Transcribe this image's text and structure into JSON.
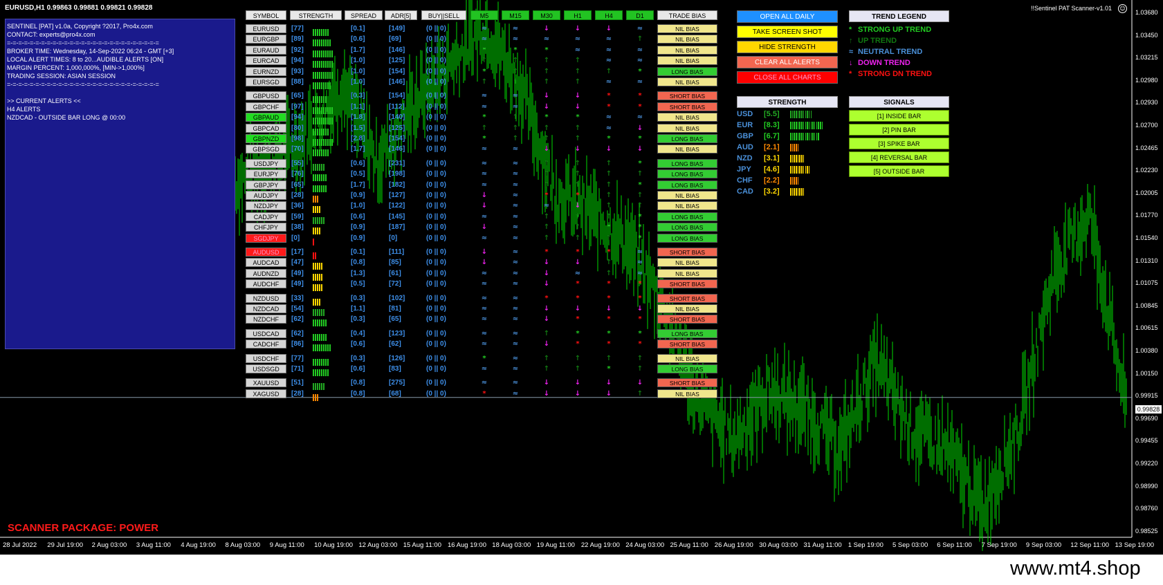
{
  "window": {
    "title": "EURUSD,H1  0.99863 0.99881 0.99821 0.99828",
    "scanner_name": "!!Sentinel PAT Scanner-v1.01"
  },
  "info_panel": {
    "lines": [
      "SENTINEL [PAT] v1.0a, Copyright ?2017, Pro4x.com",
      "CONTACT: experts@pro4x.com",
      "=-=-=-=-=-=-=-=-=-=-=-=-=-=-=-=-=-=-=-=-=-=-=-=-=-=-=",
      "BROKER TIME: Wednesday, 14-Sep-2022 06:24 - GMT [+3]",
      "LOCAL ALERT TIMES: 8 to 20...AUDIBLE ALERTS [ON]",
      "MARGIN PERCENT: 1,000,000%, [MIN->1,000%]",
      "TRADING SESSION: ASIAN SESSION",
      "=-=-=-=-=-=-=-=-=-=-=-=-=-=-=-=-=-=-=-=-=-=-=-=-=-=-=",
      "",
      ">> CURRENT ALERTS <<",
      "H4 ALERTS",
      "NZDCAD - OUTSIDE BAR LONG @ 00:00"
    ],
    "package_label": "SCANNER PACKAGE: POWER"
  },
  "table_headers": {
    "symbol": "SYMBOL",
    "strength": "STRENGTH",
    "spread": "SPREAD",
    "adr": "ADR[5]",
    "buysell": "BUY||SELL",
    "m5": "M5",
    "m15": "M15",
    "m30": "M30",
    "h1": "H1",
    "h4": "H4",
    "d1": "D1",
    "bias": "TRADE BIAS"
  },
  "colors": {
    "symbol_default": "#d6d6d6",
    "symbol_green": "#22dd22",
    "symbol_red": "#ff1a1a",
    "nil_bias": "#f0e68c",
    "long_bias": "#33cc33",
    "short_bias": "#f26650",
    "strong_up": "#22cc22",
    "up": "#117711",
    "neutral": "#4a90d9",
    "down": "#ee22ee",
    "strong_down": "#ff1111",
    "chart_line": "#00dd00",
    "number_blue": "#3d8ee8"
  },
  "pairs": [
    {
      "symbol": "EURUSD",
      "state": "default",
      "strength": "[77]",
      "spread": "[0.1]",
      "adr": "[149]",
      "buysell": "(0 || 0)",
      "tf": [
        "n",
        "n",
        "d",
        "d",
        "d",
        "n"
      ],
      "bias": "NIL BIAS",
      "bias_type": "nil",
      "bar": {
        "color": "#22cc22",
        "count": 8
      }
    },
    {
      "symbol": "EURGBP",
      "state": "default",
      "strength": "[89]",
      "spread": "[0.6]",
      "adr": "[69]",
      "buysell": "(0 || 0)",
      "tf": [
        "n",
        "n",
        "n",
        "n",
        "n",
        "u"
      ],
      "bias": "NIL BIAS",
      "bias_type": "nil",
      "bar": {
        "color": "#22cc22",
        "count": 9
      }
    },
    {
      "symbol": "EURAUD",
      "state": "default",
      "strength": "[92]",
      "spread": "[1.7]",
      "adr": "[146]",
      "buysell": "(0 || 0)",
      "tf": [
        "su",
        "su",
        "su",
        "n",
        "n",
        "n"
      ],
      "bias": "NIL BIAS",
      "bias_type": "nil",
      "bar": {
        "color": "#22cc22",
        "count": 10
      }
    },
    {
      "symbol": "EURCAD",
      "state": "default",
      "strength": "[94]",
      "spread": "[1.0]",
      "adr": "[125]",
      "buysell": "(0 || 0)",
      "tf": [
        "u",
        "u",
        "u",
        "u",
        "n",
        "n"
      ],
      "bias": "NIL BIAS",
      "bias_type": "nil",
      "bar": {
        "color": "#22cc22",
        "count": 10
      }
    },
    {
      "symbol": "EURNZD",
      "state": "default",
      "strength": "[93]",
      "spread": "[1.0]",
      "adr": "[154]",
      "buysell": "(0 || 0)",
      "tf": [
        "su",
        "u",
        "u",
        "u",
        "u",
        "su"
      ],
      "bias": "LONG BIAS",
      "bias_type": "long",
      "bar": {
        "color": "#22cc22",
        "count": 10
      }
    },
    {
      "symbol": "EURSGD",
      "state": "default",
      "strength": "[88]",
      "spread": "[1.0]",
      "adr": "[146]",
      "buysell": "(0 || 0)",
      "tf": [
        "u",
        "u",
        "u",
        "u",
        "n",
        "n"
      ],
      "bias": "NIL BIAS",
      "bias_type": "nil",
      "bar": {
        "color": "#22cc22",
        "count": 9
      }
    },
    {
      "symbol": "GBPUSD",
      "state": "default",
      "strength": "[65]",
      "spread": "[0.3]",
      "adr": "[154]",
      "buysell": "(0 || 0)",
      "tf": [
        "n",
        "n",
        "d",
        "d",
        "sd",
        "sd"
      ],
      "bias": "SHORT BIAS",
      "bias_type": "short",
      "bar": {
        "color": "#22cc22",
        "count": 7
      }
    },
    {
      "symbol": "GBPCHF",
      "state": "default",
      "strength": "[97]",
      "spread": "[1.1]",
      "adr": "[112]",
      "buysell": "(0 || 0)",
      "tf": [
        "n",
        "n",
        "d",
        "d",
        "sd",
        "sd"
      ],
      "bias": "SHORT BIAS",
      "bias_type": "short",
      "bar": {
        "color": "#22cc22",
        "count": 10
      }
    },
    {
      "symbol": "GBPAUD",
      "state": "green",
      "strength": "[94]",
      "spread": "[1.8]",
      "adr": "[140]",
      "buysell": "(0 || 0)",
      "tf": [
        "su",
        "u",
        "su",
        "su",
        "n",
        "n"
      ],
      "bias": "NIL BIAS",
      "bias_type": "nil",
      "bar": {
        "color": "#22cc22",
        "count": 10
      }
    },
    {
      "symbol": "GBPCAD",
      "state": "default",
      "strength": "[80]",
      "spread": "[1.5]",
      "adr": "[125]",
      "buysell": "(0 || 0)",
      "tf": [
        "u",
        "u",
        "u",
        "u",
        "n",
        "d"
      ],
      "bias": "NIL BIAS",
      "bias_type": "nil",
      "bar": {
        "color": "#22cc22",
        "count": 8
      }
    },
    {
      "symbol": "GBPNZD",
      "state": "green",
      "strength": "[98]",
      "spread": "[2.8]",
      "adr": "[154]",
      "buysell": "(0 || 0)",
      "tf": [
        "su",
        "u",
        "u",
        "u",
        "su",
        "su"
      ],
      "bias": "LONG BIAS",
      "bias_type": "long",
      "bar": {
        "color": "#22cc22",
        "count": 10
      }
    },
    {
      "symbol": "GBPSGD",
      "state": "default",
      "strength": "[70]",
      "spread": "[1.7]",
      "adr": "[146]",
      "buysell": "(0 || 0)",
      "tf": [
        "n",
        "n",
        "d",
        "d",
        "d",
        "d"
      ],
      "bias": "NIL BIAS",
      "bias_type": "nil",
      "bar": {
        "color": "#22cc22",
        "count": 8
      }
    },
    {
      "symbol": "USDJPY",
      "state": "default",
      "strength": "[55]",
      "spread": "[0.6]",
      "adr": "[231]",
      "buysell": "(0 || 0)",
      "tf": [
        "n",
        "n",
        "u",
        "u",
        "u",
        "su"
      ],
      "bias": "LONG BIAS",
      "bias_type": "long",
      "bar": {
        "color": "#22aa22",
        "count": 6
      }
    },
    {
      "symbol": "EURJPY",
      "state": "default",
      "strength": "[76]",
      "spread": "[0.5]",
      "adr": "[198]",
      "buysell": "(0 || 0)",
      "tf": [
        "n",
        "n",
        "u",
        "u",
        "u",
        "u"
      ],
      "bias": "LONG BIAS",
      "bias_type": "long",
      "bar": {
        "color": "#22cc22",
        "count": 7
      }
    },
    {
      "symbol": "GBPJPY",
      "state": "default",
      "strength": "[65]",
      "spread": "[1.7]",
      "adr": "[182]",
      "buysell": "(0 || 0)",
      "tf": [
        "n",
        "n",
        "u",
        "u",
        "u",
        "su"
      ],
      "bias": "LONG BIAS",
      "bias_type": "long",
      "bar": {
        "color": "#22cc22",
        "count": 7
      }
    },
    {
      "symbol": "AUDJPY",
      "state": "default",
      "strength": "[28]",
      "spread": "[0.9]",
      "adr": "[127]",
      "buysell": "(0 || 0)",
      "tf": [
        "d",
        "n",
        "sd",
        "sd",
        "u",
        "u"
      ],
      "bias": "NIL BIAS",
      "bias_type": "nil",
      "bar": {
        "color": "#ff8800",
        "count": 3
      }
    },
    {
      "symbol": "NZDJPY",
      "state": "default",
      "strength": "[36]",
      "spread": "[1.0]",
      "adr": "[122]",
      "buysell": "(0 || 0)",
      "tf": [
        "d",
        "n",
        "n",
        "d",
        "u",
        "u"
      ],
      "bias": "NIL BIAS",
      "bias_type": "nil",
      "bar": {
        "color": "#ffd700",
        "count": 4
      }
    },
    {
      "symbol": "CADJPY",
      "state": "default",
      "strength": "[59]",
      "spread": "[0.6]",
      "adr": "[145]",
      "buysell": "(0 || 0)",
      "tf": [
        "n",
        "n",
        "u",
        "u",
        "u",
        "su"
      ],
      "bias": "LONG BIAS",
      "bias_type": "long",
      "bar": {
        "color": "#22aa22",
        "count": 6
      }
    },
    {
      "symbol": "CHFJPY",
      "state": "default",
      "strength": "[38]",
      "spread": "[0.9]",
      "adr": "[187]",
      "buysell": "(0 || 0)",
      "tf": [
        "d",
        "n",
        "u",
        "u",
        "su",
        "su"
      ],
      "bias": "LONG BIAS",
      "bias_type": "long",
      "bar": {
        "color": "#ffd700",
        "count": 4
      }
    },
    {
      "symbol": "SGDJPY",
      "state": "red",
      "strength": "[0]",
      "spread": "[0.9]",
      "adr": "[0]",
      "buysell": "(0 || 0)",
      "tf": [
        "n",
        "n",
        "u",
        "u",
        "u",
        "su"
      ],
      "bias": "LONG BIAS",
      "bias_type": "long",
      "bar": {
        "color": "#ff1111",
        "count": 1
      }
    },
    {
      "symbol": "AUDUSD",
      "state": "red",
      "strength": "[17]",
      "spread": "[0.1]",
      "adr": "[111]",
      "buysell": "(0 || 0)",
      "tf": [
        "d",
        "n",
        "sd",
        "sd",
        "sd",
        "n"
      ],
      "bias": "SHORT BIAS",
      "bias_type": "short",
      "bar": {
        "color": "#ff1111",
        "count": 2
      }
    },
    {
      "symbol": "AUDCAD",
      "state": "default",
      "strength": "[47]",
      "spread": "[0.8]",
      "adr": "[85]",
      "buysell": "(0 || 0)",
      "tf": [
        "d",
        "n",
        "d",
        "d",
        "u",
        "n"
      ],
      "bias": "NIL BIAS",
      "bias_type": "nil",
      "bar": {
        "color": "#ffd700",
        "count": 5
      }
    },
    {
      "symbol": "AUDNZD",
      "state": "default",
      "strength": "[49]",
      "spread": "[1.3]",
      "adr": "[61]",
      "buysell": "(0 || 0)",
      "tf": [
        "n",
        "n",
        "d",
        "n",
        "u",
        "n"
      ],
      "bias": "NIL BIAS",
      "bias_type": "nil",
      "bar": {
        "color": "#ffd700",
        "count": 5
      }
    },
    {
      "symbol": "AUDCHF",
      "state": "default",
      "strength": "[49]",
      "spread": "[0.5]",
      "adr": "[72]",
      "buysell": "(0 || 0)",
      "tf": [
        "n",
        "n",
        "d",
        "sd",
        "sd",
        "sd"
      ],
      "bias": "SHORT BIAS",
      "bias_type": "short",
      "bar": {
        "color": "#ffd700",
        "count": 5
      }
    },
    {
      "symbol": "NZDUSD",
      "state": "default",
      "strength": "[33]",
      "spread": "[0.3]",
      "adr": "[102]",
      "buysell": "(0 || 0)",
      "tf": [
        "n",
        "n",
        "sd",
        "sd",
        "sd",
        "sd"
      ],
      "bias": "SHORT BIAS",
      "bias_type": "short",
      "bar": {
        "color": "#ffd700",
        "count": 4
      }
    },
    {
      "symbol": "NZDCAD",
      "state": "default",
      "strength": "[54]",
      "spread": "[1.1]",
      "adr": "[81]",
      "buysell": "(0 || 0)",
      "tf": [
        "n",
        "n",
        "d",
        "d",
        "d",
        "d"
      ],
      "bias": "NIL BIAS",
      "bias_type": "nil",
      "bar": {
        "color": "#22aa22",
        "count": 6
      }
    },
    {
      "symbol": "NZDCHF",
      "state": "default",
      "strength": "[62]",
      "spread": "[0.3]",
      "adr": "[65]",
      "buysell": "(0 || 0)",
      "tf": [
        "n",
        "n",
        "d",
        "sd",
        "sd",
        "sd"
      ],
      "bias": "SHORT BIAS",
      "bias_type": "short",
      "bar": {
        "color": "#22cc22",
        "count": 7
      }
    },
    {
      "symbol": "USDCAD",
      "state": "default",
      "strength": "[62]",
      "spread": "[0.4]",
      "adr": "[123]",
      "buysell": "(0 || 0)",
      "tf": [
        "n",
        "n",
        "u",
        "su",
        "su",
        "su"
      ],
      "bias": "LONG BIAS",
      "bias_type": "long",
      "bar": {
        "color": "#22cc22",
        "count": 7
      }
    },
    {
      "symbol": "CADCHF",
      "state": "default",
      "strength": "[86]",
      "spread": "[0.6]",
      "adr": "[62]",
      "buysell": "(0 || 0)",
      "tf": [
        "n",
        "n",
        "d",
        "sd",
        "sd",
        "sd"
      ],
      "bias": "SHORT BIAS",
      "bias_type": "short",
      "bar": {
        "color": "#22cc22",
        "count": 9
      }
    },
    {
      "symbol": "USDCHF",
      "state": "default",
      "strength": "[77]",
      "spread": "[0.3]",
      "adr": "[126]",
      "buysell": "(0 || 0)",
      "tf": [
        "su",
        "n",
        "u",
        "u",
        "u",
        "u"
      ],
      "bias": "NIL BIAS",
      "bias_type": "nil",
      "bar": {
        "color": "#22cc22",
        "count": 8
      }
    },
    {
      "symbol": "USDSGD",
      "state": "default",
      "strength": "[71]",
      "spread": "[0.6]",
      "adr": "[83]",
      "buysell": "(0 || 0)",
      "tf": [
        "n",
        "n",
        "u",
        "u",
        "su",
        "u"
      ],
      "bias": "LONG BIAS",
      "bias_type": "long",
      "bar": {
        "color": "#22cc22",
        "count": 8
      }
    },
    {
      "symbol": "XAUUSD",
      "state": "default",
      "strength": "[51]",
      "spread": "[0.8]",
      "adr": "[275]",
      "buysell": "(0 || 0)",
      "tf": [
        "n",
        "n",
        "d",
        "d",
        "d",
        "d"
      ],
      "bias": "SHORT BIAS",
      "bias_type": "short",
      "bar": {
        "color": "#22aa22",
        "count": 6
      }
    },
    {
      "symbol": "XAGUSD",
      "state": "default",
      "strength": "[28]",
      "spread": "[0.8]",
      "adr": "[68]",
      "buysell": "(0 || 0)",
      "tf": [
        "sd",
        "n",
        "d",
        "d",
        "d",
        "u"
      ],
      "bias": "NIL BIAS",
      "bias_type": "nil",
      "bar": {
        "color": "#ff8800",
        "count": 3
      }
    }
  ],
  "buttons": [
    {
      "label": "OPEN ALL DAILY",
      "bg": "#1e90ff",
      "fg": "#ffffff"
    },
    {
      "label": "TAKE SCREEN SHOT",
      "bg": "#ffff00",
      "fg": "#000000"
    },
    {
      "label": "HIDE STRENGTH",
      "bg": "#ffd700",
      "fg": "#000000"
    },
    {
      "label": "CLEAR ALL ALERTS",
      "bg": "#f26650",
      "fg": "#ffffff"
    },
    {
      "label": "CLOSE ALL CHARTS",
      "bg": "#ff0000",
      "fg": "#ff99cc"
    }
  ],
  "trend_legend": {
    "title": "TREND LEGEND",
    "items": [
      {
        "glyph": "*",
        "label": "STRONG UP TREND",
        "color": "#22cc22"
      },
      {
        "glyph": "↑",
        "label": "UP TREND",
        "color": "#117711"
      },
      {
        "glyph": "≈",
        "label": "NEUTRAL TREND",
        "color": "#4a90d9"
      },
      {
        "glyph": "↓",
        "label": "DOWN TREND",
        "color": "#ee22ee"
      },
      {
        "glyph": "*",
        "label": "STRONG DN TREND",
        "color": "#ff1111"
      }
    ]
  },
  "strength_panel": {
    "title": "STRENGTH",
    "items": [
      {
        "currency": "USD",
        "value": "[5.5]",
        "color": "#22aa22",
        "count": 12
      },
      {
        "currency": "EUR",
        "value": "[8.3]",
        "color": "#22cc22",
        "count": 18
      },
      {
        "currency": "GBP",
        "value": "[6.7]",
        "color": "#22cc22",
        "count": 16
      },
      {
        "currency": "AUD",
        "value": "[2.1]",
        "color": "#ff8800",
        "count": 5
      },
      {
        "currency": "NZD",
        "value": "[3.1]",
        "color": "#ffd700",
        "count": 8
      },
      {
        "currency": "JPY",
        "value": "[4.6]",
        "color": "#ffd700",
        "count": 11
      },
      {
        "currency": "CHF",
        "value": "[2.2]",
        "color": "#ff8800",
        "count": 5
      },
      {
        "currency": "CAD",
        "value": "[3.2]",
        "color": "#ffd700",
        "count": 8
      }
    ]
  },
  "signals_panel": {
    "title": "SIGNALS",
    "items": [
      "[1] INSIDE BAR",
      "[2] PIN BAR",
      "[3] SPIKE BAR",
      "[4] REVERSAL BAR",
      "[5] OUTSIDE BAR"
    ]
  },
  "price_axis": [
    "1.03680",
    "1.03450",
    "1.03215",
    "1.02980",
    "1.02930",
    "1.02700",
    "1.02465",
    "1.02230",
    "1.02005",
    "1.01770",
    "1.01540",
    "1.01310",
    "1.01075",
    "1.00845",
    "1.00615",
    "1.00380",
    "1.00150",
    "0.99915",
    "0.99690",
    "0.99455",
    "0.99220",
    "0.98990",
    "0.98760",
    "0.98525"
  ],
  "current_price": "0.99828",
  "date_axis": [
    "28 Jul 2022",
    "29 Jul 19:00",
    "2 Aug 03:00",
    "3 Aug 11:00",
    "4 Aug 19:00",
    "8 Aug 03:00",
    "9 Aug 11:00",
    "10 Aug 19:00",
    "12 Aug 03:00",
    "15 Aug 11:00",
    "16 Aug 19:00",
    "18 Aug 03:00",
    "19 Aug 11:00",
    "22 Aug 19:00",
    "24 Aug 03:00",
    "25 Aug 11:00",
    "26 Aug 19:00",
    "30 Aug 03:00",
    "31 Aug 11:00",
    "1 Sep 19:00",
    "5 Sep 03:00",
    "6 Sep 11:00",
    "7 Sep 19:00",
    "9 Sep 03:00",
    "12 Sep 11:00",
    "13 Sep 19:00"
  ],
  "watermark": "www.mt4.shop",
  "chart_data": {
    "type": "line",
    "symbol": "EURUSD,H1",
    "x": [
      "28 Jul 2022",
      "29 Jul 19:00",
      "2 Aug 03:00",
      "3 Aug 11:00",
      "4 Aug 19:00",
      "8 Aug 03:00",
      "9 Aug 11:00",
      "10 Aug 19:00",
      "12 Aug 03:00",
      "15 Aug 11:00",
      "16 Aug 19:00",
      "18 Aug 03:00",
      "19 Aug 11:00",
      "22 Aug 19:00",
      "24 Aug 03:00",
      "25 Aug 11:00",
      "26 Aug 19:00",
      "30 Aug 03:00",
      "31 Aug 11:00",
      "1 Sep 19:00",
      "5 Sep 03:00",
      "6 Sep 11:00",
      "7 Sep 19:00",
      "9 Sep 03:00",
      "12 Sep 11:00",
      "13 Sep 19:00"
    ],
    "values": [
      1.02,
      1.022,
      1.025,
      1.03,
      1.022,
      1.028,
      1.032,
      1.036,
      1.03,
      1.019,
      1.017,
      1.014,
      1.008,
      0.998,
      0.994,
      0.999,
      0.997,
      0.993,
      1.002,
      0.995,
      0.993,
      0.987,
      0.995,
      1.011,
      1.017,
      0.998
    ],
    "ylim": [
      0.9841,
      1.038
    ],
    "current_price": 0.99828,
    "grid": false
  }
}
